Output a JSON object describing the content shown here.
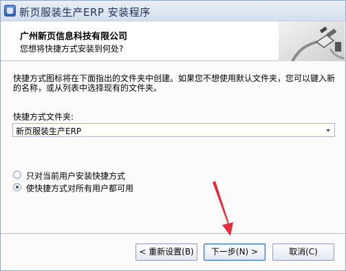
{
  "window": {
    "title": "新页服装生产ERP 安装程序"
  },
  "header": {
    "company": "广州新页信息科技有限公司",
    "question": "您想将快捷方式安装到何处?"
  },
  "main": {
    "description": "快捷方式图标将在下面指出的文件夹中创建。如果您不想使用默认文件夹，您可以键入新的名称，或从列表中选择现有的文件夹。",
    "folder_label": "快捷方式文件夹:",
    "folder_value": "新页服装生产ERP",
    "radio_options": [
      {
        "label": "只对当前用户安装快捷方式",
        "checked": false
      },
      {
        "label": "使快捷方式对所有用户都可用",
        "checked": true
      }
    ]
  },
  "buttons": {
    "back": "< 重新设置(B)",
    "next": "下一步(N) >",
    "cancel": "取消(C)"
  },
  "colors": {
    "accent": "#3c6fb0",
    "annotation_arrow": "#e8283c"
  },
  "icons": {
    "app": "installer-app-icon",
    "header_graphic": "plug-cable-icon",
    "annotation": "red-arrow-icon"
  }
}
